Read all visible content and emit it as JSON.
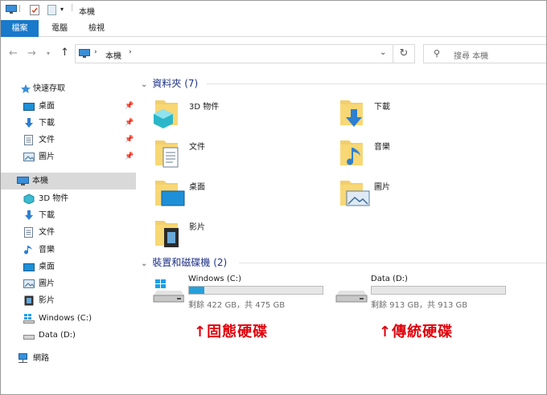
{
  "window": {
    "title": "本機"
  },
  "ribbon": {
    "tabs": [
      "檔案",
      "電腦",
      "檢視"
    ]
  },
  "address": {
    "path": "本機",
    "search_placeholder": "搜尋 本機"
  },
  "nav": {
    "quick_access": "快速存取",
    "quick_items": [
      "桌面",
      "下載",
      "文件",
      "圖片"
    ],
    "this_pc": "本機",
    "pc_items": [
      "3D 物件",
      "下載",
      "文件",
      "音樂",
      "桌面",
      "圖片",
      "影片",
      "Windows (C:)",
      "Data (D:)"
    ],
    "network": "網路"
  },
  "folders": {
    "header": "資料夾 (7)",
    "items": [
      "3D 物件",
      "下載",
      "文件",
      "音樂",
      "桌面",
      "圖片",
      "影片"
    ]
  },
  "drives": {
    "header": "裝置和磁碟機 (2)",
    "items": [
      {
        "name": "Windows (C:)",
        "free_text": "剩餘 422 GB，共 475 GB",
        "used_fraction": 0.112
      },
      {
        "name": "Data (D:)",
        "free_text": "剩餘 913 GB，共 913 GB",
        "used_fraction": 0.0
      }
    ]
  },
  "annotations": {
    "c_drive": "↑固態硬碟",
    "d_drive": "↑傳統硬碟"
  },
  "colors": {
    "accent": "#1979ca",
    "drive_fill": "#26a0da",
    "annotation": "#e0000a",
    "group_header": "#1e3287"
  }
}
